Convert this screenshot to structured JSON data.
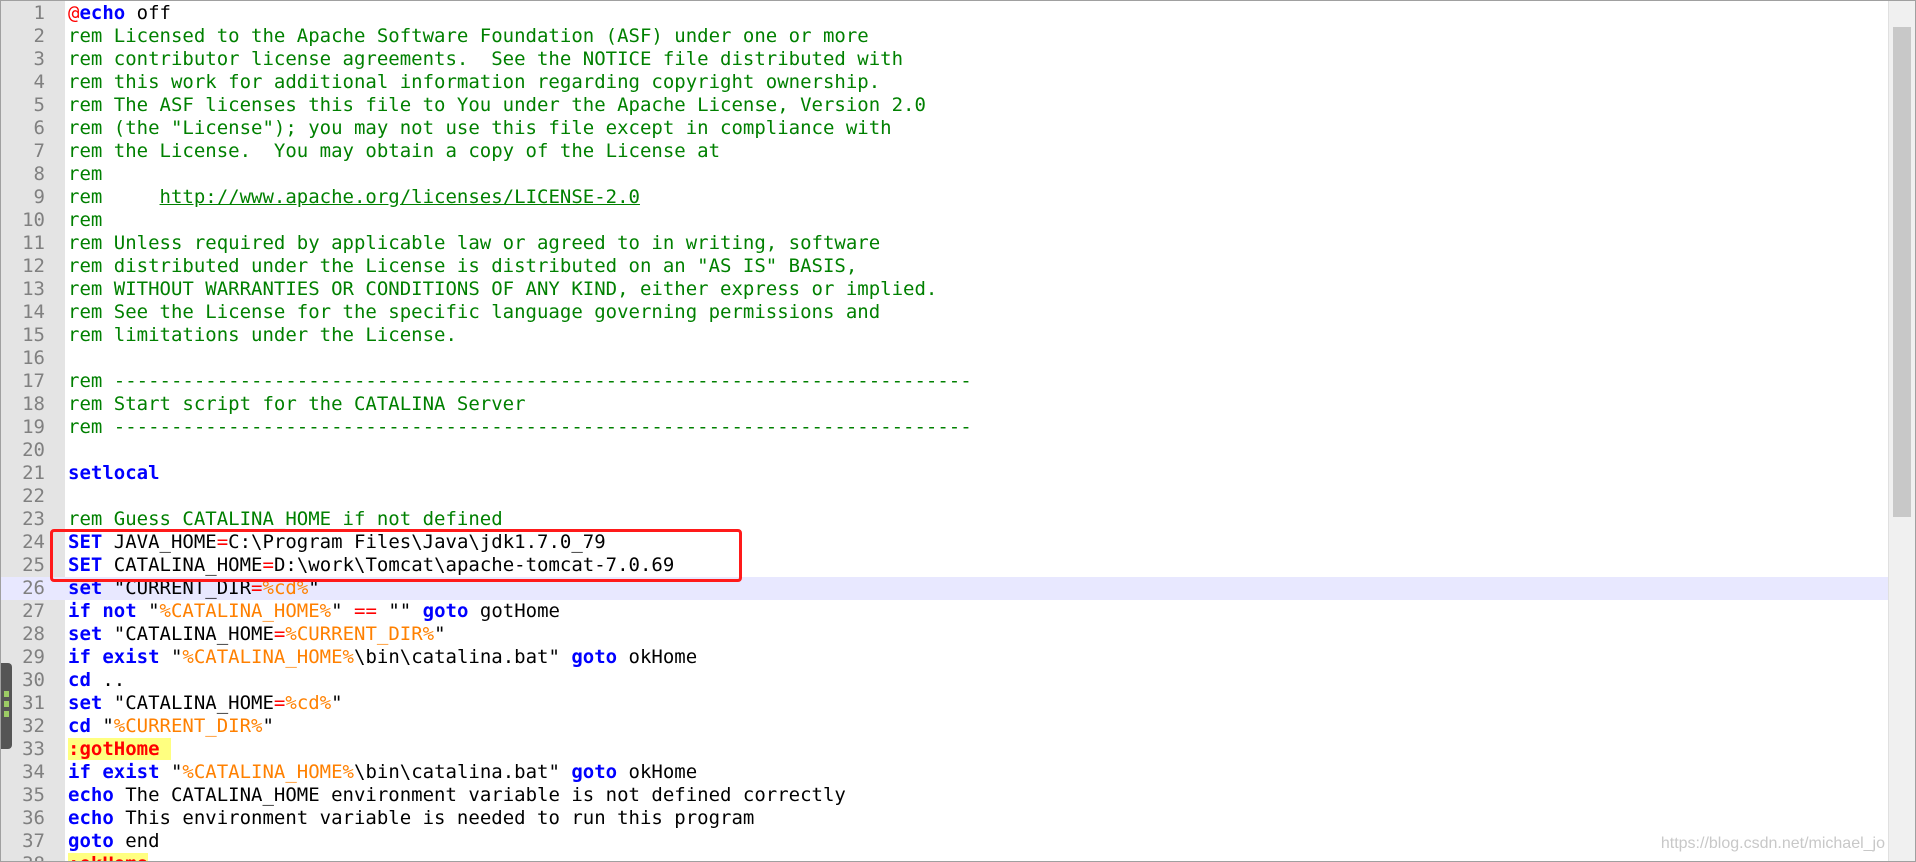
{
  "editor": {
    "lines": [
      {
        "n": "1",
        "tokens": [
          {
            "t": "@",
            "c": "op"
          },
          {
            "t": "echo",
            "c": "kw"
          },
          {
            "t": " off",
            "c": "text"
          }
        ]
      },
      {
        "n": "2",
        "tokens": [
          {
            "t": "rem Licensed to the Apache Software Foundation (ASF) under one or more",
            "c": "comment"
          }
        ]
      },
      {
        "n": "3",
        "tokens": [
          {
            "t": "rem contributor license agreements.  See the NOTICE file distributed with",
            "c": "comment"
          }
        ]
      },
      {
        "n": "4",
        "tokens": [
          {
            "t": "rem this work for additional information regarding copyright ownership.",
            "c": "comment"
          }
        ]
      },
      {
        "n": "5",
        "tokens": [
          {
            "t": "rem The ASF licenses this file to You under the Apache License, Version 2.0",
            "c": "comment"
          }
        ]
      },
      {
        "n": "6",
        "tokens": [
          {
            "t": "rem (the \"License\"); you may not use this file except in compliance with",
            "c": "comment"
          }
        ]
      },
      {
        "n": "7",
        "tokens": [
          {
            "t": "rem the License.  You may obtain a copy of the License at",
            "c": "comment"
          }
        ]
      },
      {
        "n": "8",
        "tokens": [
          {
            "t": "rem",
            "c": "comment"
          }
        ]
      },
      {
        "n": "9",
        "tokens": [
          {
            "t": "rem     ",
            "c": "comment"
          },
          {
            "t": "http://www.apache.org/licenses/LICENSE-2.0",
            "c": "link"
          }
        ]
      },
      {
        "n": "10",
        "tokens": [
          {
            "t": "rem",
            "c": "comment"
          }
        ]
      },
      {
        "n": "11",
        "tokens": [
          {
            "t": "rem Unless required by applicable law or agreed to in writing, software",
            "c": "comment"
          }
        ]
      },
      {
        "n": "12",
        "tokens": [
          {
            "t": "rem distributed under the License is distributed on an \"AS IS\" BASIS,",
            "c": "comment"
          }
        ]
      },
      {
        "n": "13",
        "tokens": [
          {
            "t": "rem WITHOUT WARRANTIES OR CONDITIONS OF ANY KIND, either express or implied.",
            "c": "comment"
          }
        ]
      },
      {
        "n": "14",
        "tokens": [
          {
            "t": "rem See the License for the specific language governing permissions and",
            "c": "comment"
          }
        ]
      },
      {
        "n": "15",
        "tokens": [
          {
            "t": "rem limitations under the License.",
            "c": "comment"
          }
        ]
      },
      {
        "n": "16",
        "tokens": []
      },
      {
        "n": "17",
        "tokens": [
          {
            "t": "rem ---------------------------------------------------------------------------",
            "c": "comment"
          }
        ]
      },
      {
        "n": "18",
        "tokens": [
          {
            "t": "rem Start script for the CATALINA Server",
            "c": "comment"
          }
        ]
      },
      {
        "n": "19",
        "tokens": [
          {
            "t": "rem ---------------------------------------------------------------------------",
            "c": "comment"
          }
        ]
      },
      {
        "n": "20",
        "tokens": []
      },
      {
        "n": "21",
        "tokens": [
          {
            "t": "setlocal",
            "c": "kw"
          }
        ]
      },
      {
        "n": "22",
        "tokens": []
      },
      {
        "n": "23",
        "tokens": [
          {
            "t": "rem Guess CATALINA_HOME if not defined",
            "c": "comment"
          }
        ]
      },
      {
        "n": "24",
        "tokens": [
          {
            "t": "SET",
            "c": "kw"
          },
          {
            "t": " JAVA_HOME",
            "c": "text"
          },
          {
            "t": "=",
            "c": "op"
          },
          {
            "t": "C:\\Program Files\\Java\\jdk1.7.0_79",
            "c": "text"
          }
        ]
      },
      {
        "n": "25",
        "tokens": [
          {
            "t": "SET",
            "c": "kw"
          },
          {
            "t": " CATALINA_HOME",
            "c": "text"
          },
          {
            "t": "=",
            "c": "op"
          },
          {
            "t": "D:\\work\\Tomcat\\apache-tomcat-7.0.69",
            "c": "text"
          }
        ]
      },
      {
        "n": "26",
        "current": true,
        "tokens": [
          {
            "t": "set",
            "c": "kw"
          },
          {
            "t": " \"CURRENT_DIR",
            "c": "text"
          },
          {
            "t": "=",
            "c": "op"
          },
          {
            "t": "%cd%",
            "c": "var"
          },
          {
            "t": "\"",
            "c": "text"
          }
        ]
      },
      {
        "n": "27",
        "tokens": [
          {
            "t": "if not",
            "c": "kw"
          },
          {
            "t": " \"",
            "c": "text"
          },
          {
            "t": "%CATALINA_HOME%",
            "c": "var"
          },
          {
            "t": "\" ",
            "c": "text"
          },
          {
            "t": "==",
            "c": "op"
          },
          {
            "t": " \"\" ",
            "c": "text"
          },
          {
            "t": "goto",
            "c": "kw"
          },
          {
            "t": " gotHome",
            "c": "text"
          }
        ]
      },
      {
        "n": "28",
        "tokens": [
          {
            "t": "set",
            "c": "kw"
          },
          {
            "t": " \"CATALINA_HOME",
            "c": "text"
          },
          {
            "t": "=",
            "c": "op"
          },
          {
            "t": "%CURRENT_DIR%",
            "c": "var"
          },
          {
            "t": "\"",
            "c": "text"
          }
        ]
      },
      {
        "n": "29",
        "tokens": [
          {
            "t": "if exist",
            "c": "kw"
          },
          {
            "t": " \"",
            "c": "text"
          },
          {
            "t": "%CATALINA_HOME%",
            "c": "var"
          },
          {
            "t": "\\bin\\catalina.bat\" ",
            "c": "text"
          },
          {
            "t": "goto",
            "c": "kw"
          },
          {
            "t": " okHome",
            "c": "text"
          }
        ]
      },
      {
        "n": "30",
        "tokens": [
          {
            "t": "cd",
            "c": "kw"
          },
          {
            "t": " ..",
            "c": "text"
          }
        ]
      },
      {
        "n": "31",
        "tokens": [
          {
            "t": "set",
            "c": "kw"
          },
          {
            "t": " \"CATALINA_HOME",
            "c": "text"
          },
          {
            "t": "=",
            "c": "op"
          },
          {
            "t": "%cd%",
            "c": "var"
          },
          {
            "t": "\"",
            "c": "text"
          }
        ]
      },
      {
        "n": "32",
        "tokens": [
          {
            "t": "cd",
            "c": "kw"
          },
          {
            "t": " \"",
            "c": "text"
          },
          {
            "t": "%CURRENT_DIR%",
            "c": "var"
          },
          {
            "t": "\"",
            "c": "text"
          }
        ]
      },
      {
        "n": "33",
        "tokens": [
          {
            "t": ":gotHome ",
            "c": "label"
          }
        ]
      },
      {
        "n": "34",
        "tokens": [
          {
            "t": "if exist",
            "c": "kw"
          },
          {
            "t": " \"",
            "c": "text"
          },
          {
            "t": "%CATALINA_HOME%",
            "c": "var"
          },
          {
            "t": "\\bin\\catalina.bat\" ",
            "c": "text"
          },
          {
            "t": "goto",
            "c": "kw"
          },
          {
            "t": " okHome",
            "c": "text"
          }
        ]
      },
      {
        "n": "35",
        "tokens": [
          {
            "t": "echo",
            "c": "kw"
          },
          {
            "t": " The CATALINA_HOME environment variable is not defined correctly",
            "c": "text"
          }
        ]
      },
      {
        "n": "36",
        "tokens": [
          {
            "t": "echo",
            "c": "kw"
          },
          {
            "t": " This environment variable is needed to run this program",
            "c": "text"
          }
        ]
      },
      {
        "n": "37",
        "tokens": [
          {
            "t": "goto",
            "c": "kw"
          },
          {
            "t": " end",
            "c": "text"
          }
        ]
      },
      {
        "n": "38",
        "tokens": [
          {
            "t": ":okHome",
            "c": "label"
          }
        ]
      }
    ]
  },
  "highlight_note": "red-box-around-lines-24-25",
  "watermark": "https://blog.csdn.net/michael_jo",
  "colors": {
    "comment": "#008000",
    "keyword": "#0000ff",
    "operator": "#ff0000",
    "variable": "#ff8000",
    "label_bg": "#ffff80",
    "highlight_box": "#ff1a1a",
    "current_line": "#e8e8ff"
  }
}
